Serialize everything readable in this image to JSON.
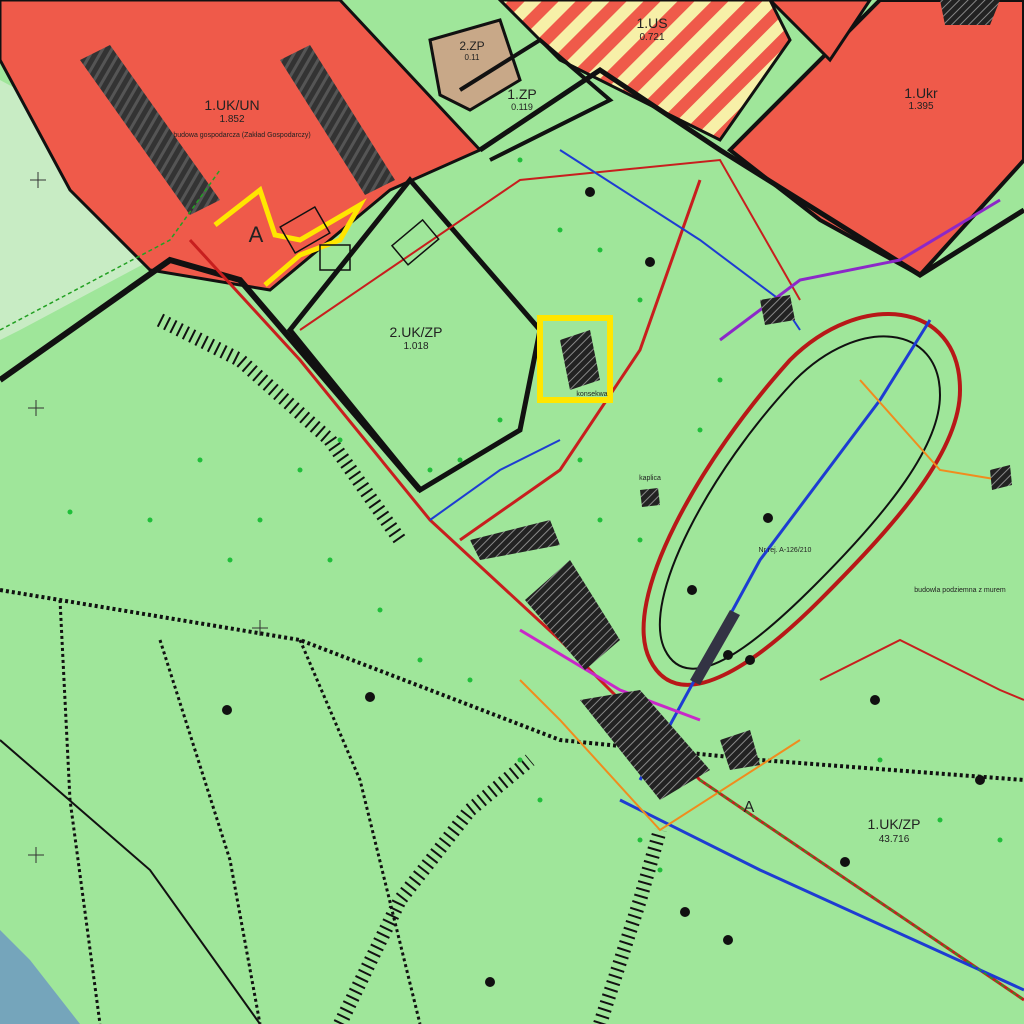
{
  "zones": {
    "uk_un": {
      "code": "1.UK/UN",
      "area": "1.852",
      "note": "budowa gospodarcza (Zakład Gospodarczy)"
    },
    "us": {
      "code": "1.US",
      "area": "0.721"
    },
    "zp_small": {
      "code": "1.ZP",
      "area": "0.119"
    },
    "ukr": {
      "code": "1.Ukr",
      "area": "1.395"
    },
    "uk_zp_2": {
      "code": "2.UK/ZP",
      "area": "1.018"
    },
    "uk_zp_1": {
      "code": "1.UK/ZP",
      "area": "43.716"
    },
    "small_top": {
      "code": "2.ZP",
      "area": "0.11"
    }
  },
  "annotations": {
    "area_letter": "A",
    "area_letter_2": "A",
    "kaplica": "kaplica",
    "building_word": "konsekwa",
    "nr_rej": "Nr rej. A-126/210",
    "budowla": "budowla podziemna z murem"
  },
  "colors": {
    "background": "#9fe69a",
    "zone_red": "#ef5a4a",
    "brown": "#c8a888",
    "highlight_yellow": "#ffe600",
    "pipe_red": "#c81e1e",
    "pipe_blue": "#1e3cd2",
    "pipe_purple": "#8c28c8",
    "pipe_orange": "#f08c1e"
  }
}
